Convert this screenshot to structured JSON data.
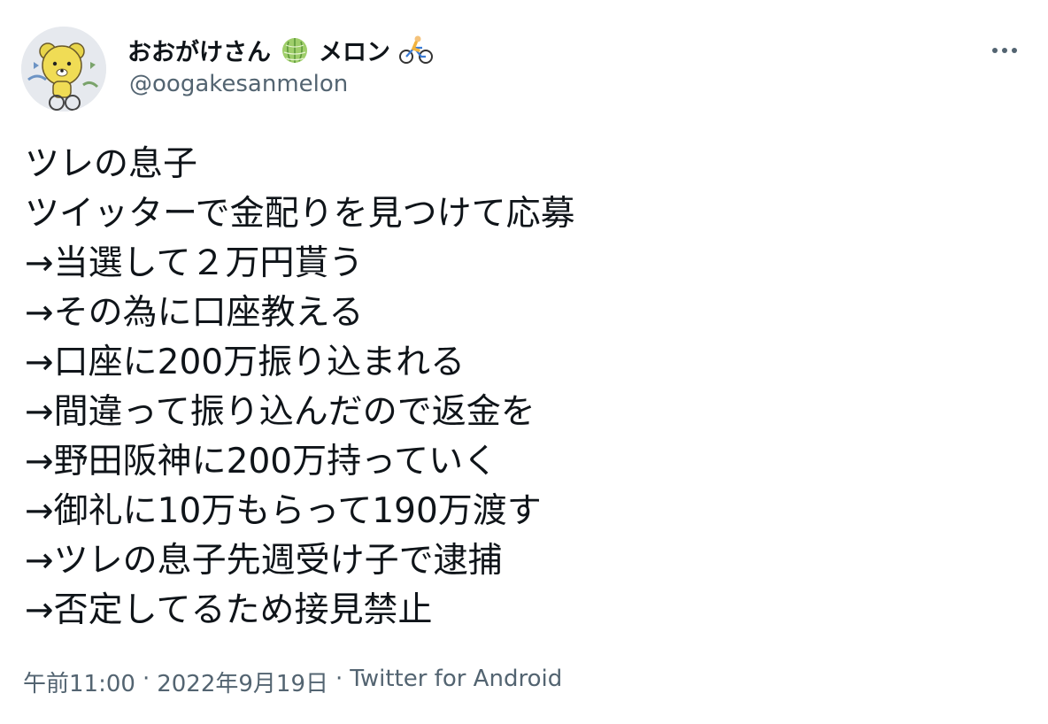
{
  "user": {
    "display_name": "おおがけさん",
    "display_name_suffix": "メロン",
    "handle": "@oogakesanmelon",
    "avatar_icon": "bear-avatar-icon",
    "emoji_1": "melon-icon",
    "emoji_2": "cyclist-icon"
  },
  "tweet": {
    "lines": [
      "ツレの息子",
      "ツイッターで金配りを見つけて応募",
      "→当選して２万円貰う",
      "→その為に口座教える",
      "→口座に200万振り込まれる",
      "→間違って振り込んだので返金を",
      "→野田阪神に200万持っていく",
      "→御礼に10万もらって190万渡す",
      "→ツレの息子先週受け子で逮捕",
      "→否定してるため接見禁止"
    ]
  },
  "meta": {
    "time": "午前11:00",
    "separator": "·",
    "date": "2022年9月19日",
    "source": "Twitter for Android"
  },
  "icons": {
    "more": "more-icon"
  },
  "colors": {
    "text": "#0f1419",
    "secondary": "#536471"
  }
}
